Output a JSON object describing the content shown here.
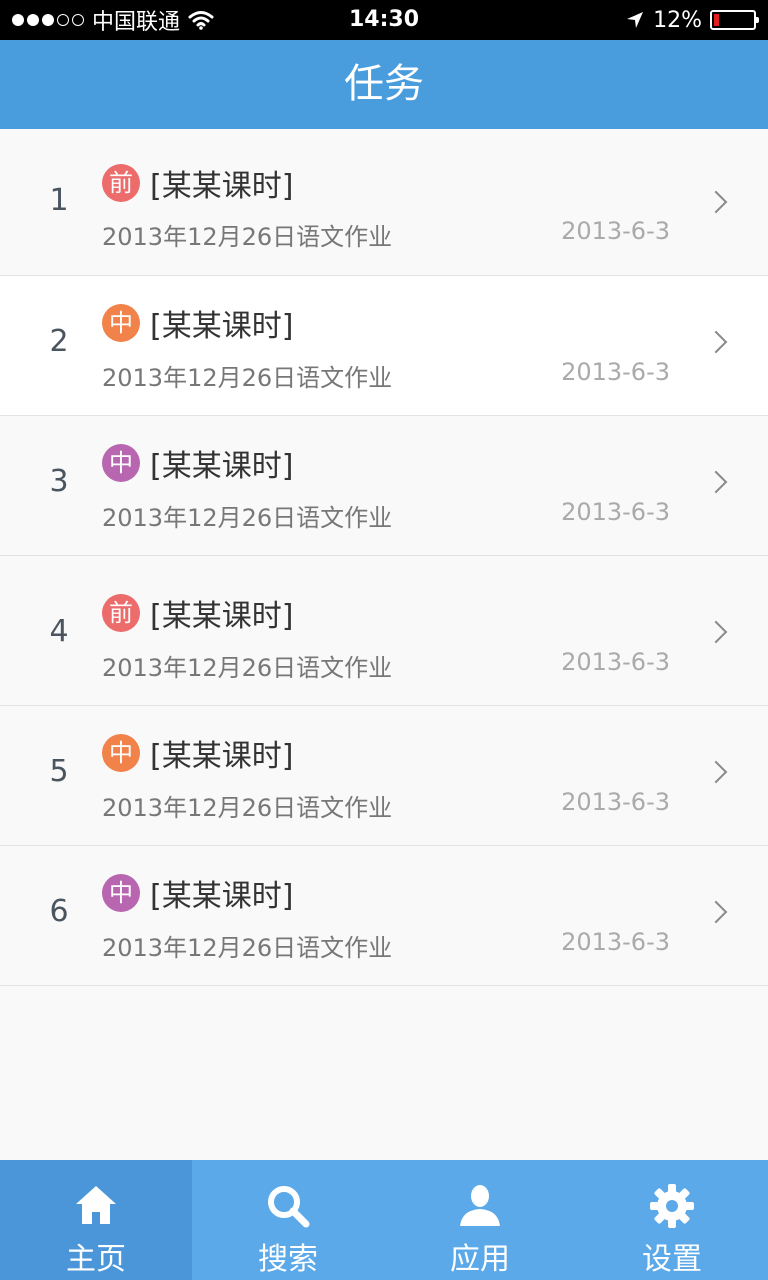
{
  "status_bar": {
    "carrier": "中国联通",
    "time": "14:30",
    "battery_percent": "12%"
  },
  "nav": {
    "title": "任务"
  },
  "colors": {
    "nav_bg": "#4a9ddd",
    "tab_bg": "#5ba9e8",
    "tab_active_bg": "#4a96d8",
    "badge_qian": "#ec6b6b",
    "badge_zhong_orange": "#f0824a",
    "badge_zhong_purple": "#b866b0"
  },
  "tasks": [
    {
      "index": "1",
      "badge": "前",
      "badge_color": "#ec6b6b",
      "title": "[某某课时]",
      "subtitle": "2013年12月26日语文作业",
      "date": "2013-6-3"
    },
    {
      "index": "2",
      "badge": "中",
      "badge_color": "#f0824a",
      "title": "[某某课时]",
      "subtitle": "2013年12月26日语文作业",
      "date": "2013-6-3"
    },
    {
      "index": "3",
      "badge": "中",
      "badge_color": "#b866b0",
      "title": "[某某课时]",
      "subtitle": "2013年12月26日语文作业",
      "date": "2013-6-3"
    },
    {
      "index": "4",
      "badge": "前",
      "badge_color": "#ec6b6b",
      "title": "[某某课时]",
      "subtitle": "2013年12月26日语文作业",
      "date": "2013-6-3"
    },
    {
      "index": "5",
      "badge": "中",
      "badge_color": "#f0824a",
      "title": "[某某课时]",
      "subtitle": "2013年12月26日语文作业",
      "date": "2013-6-3"
    },
    {
      "index": "6",
      "badge": "中",
      "badge_color": "#b866b0",
      "title": "[某某课时]",
      "subtitle": "2013年12月26日语文作业",
      "date": "2013-6-3"
    }
  ],
  "tabs": [
    {
      "label": "主页",
      "icon": "home-icon",
      "active": true
    },
    {
      "label": "搜索",
      "icon": "search-icon",
      "active": false
    },
    {
      "label": "应用",
      "icon": "user-icon",
      "active": false
    },
    {
      "label": "设置",
      "icon": "gear-icon",
      "active": false
    }
  ]
}
